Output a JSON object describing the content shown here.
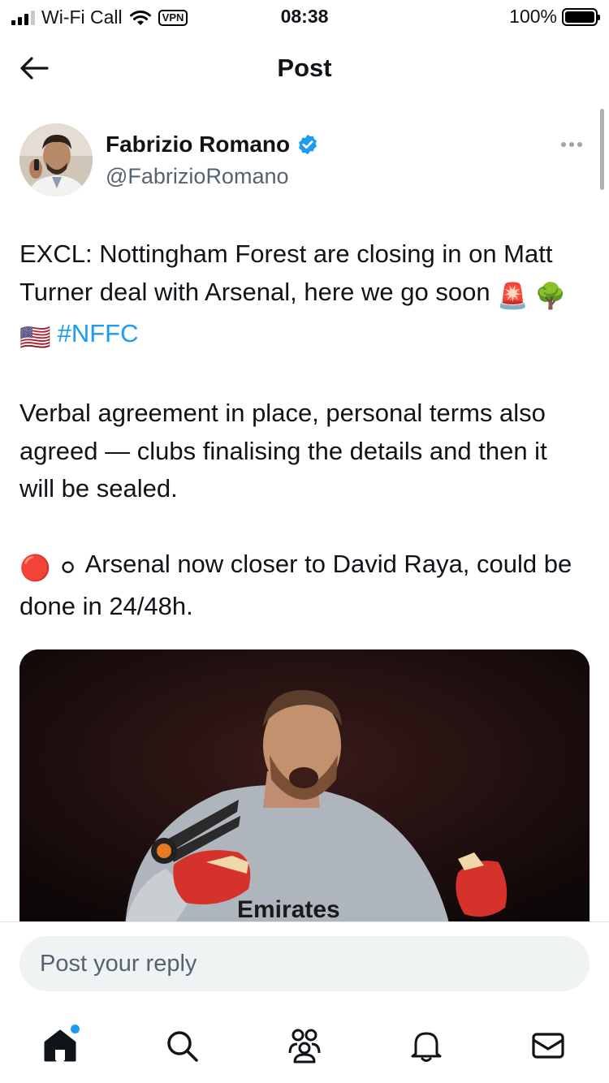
{
  "status_bar": {
    "carrier": "Wi-Fi Call",
    "vpn": "VPN",
    "time": "08:38",
    "battery": "100%",
    "battery_level": 1.0
  },
  "header": {
    "title": "Post",
    "back_icon": "arrow-left-icon"
  },
  "post": {
    "author_name": "Fabrizio Romano",
    "author_handle": "@FabrizioRomano",
    "verified": true,
    "paragraph1_text": "EXCL: Nottingham Forest are closing in on Matt Turner deal with Arsenal, here we go soon",
    "paragraph1_emojis": [
      "🚨",
      "🌳",
      "🇺🇸"
    ],
    "hashtag": "#NFFC",
    "paragraph2": "Verbal agreement in place, personal terms also agreed — clubs finalising the details and then it will be sealed.",
    "paragraph3_emojis": [
      "🔴",
      "⚪"
    ],
    "paragraph3_text": "Arsenal now closer to David Raya, could be done in 24/48h.",
    "media_text": "Emirates"
  },
  "reply": {
    "placeholder": "Post your reply"
  },
  "nav": {
    "items": [
      "home-icon",
      "search-icon",
      "communities-icon",
      "notifications-icon",
      "messages-icon"
    ],
    "home_has_notification": true
  },
  "colors": {
    "accent": "#1d9bf0",
    "text": "#0f1419",
    "secondary_text": "#536471",
    "reply_bg": "#eff3f4"
  }
}
